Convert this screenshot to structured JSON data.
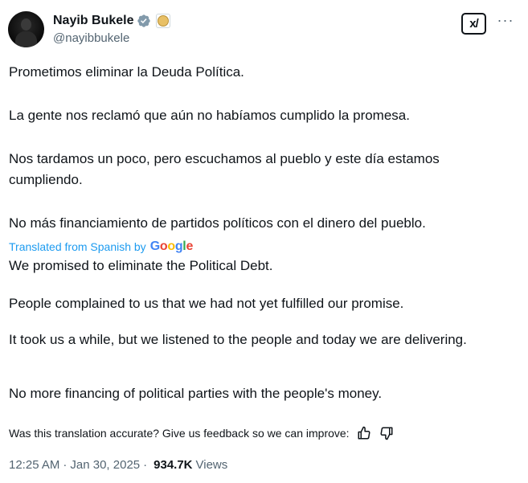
{
  "author": {
    "name": "Nayib Bukele",
    "handle": "@nayibbukele",
    "verified_icon": "verified-badge-icon",
    "affiliation_icon": "government-seal-icon"
  },
  "actions": {
    "grok_label": "x/",
    "more_label": "···"
  },
  "original": {
    "p1": "Prometimos eliminar la Deuda Política.",
    "p2": "La gente nos reclamó que aún no habíamos cumplido la promesa.",
    "p3": "Nos tardamos un poco, pero escuchamos al pueblo y este día estamos cumpliendo.",
    "p4": "No más financiamiento de partidos políticos con el dinero del pueblo."
  },
  "translation_notice": {
    "text": "Translated from Spanish by",
    "brand": "Google"
  },
  "translation": {
    "p1": "We promised to eliminate the Political Debt.",
    "p2": "People complained to us that we had not yet fulfilled our promise.",
    "p3": "It took us a while, but we listened to the people and today we are delivering.",
    "p4": "No more financing of political parties with the people's money."
  },
  "feedback": {
    "text": "Was this translation accurate? Give us feedback so we can improve:",
    "up_icon": "thumbs-up-icon",
    "down_icon": "thumbs-down-icon"
  },
  "meta": {
    "time": "12:25 AM",
    "separator": "·",
    "date": "Jan 30, 2025",
    "views_count": "934.7K",
    "views_label": "Views"
  },
  "colors": {
    "text": "#0f1419",
    "secondary": "#536471",
    "link": "#1d9bf0"
  }
}
